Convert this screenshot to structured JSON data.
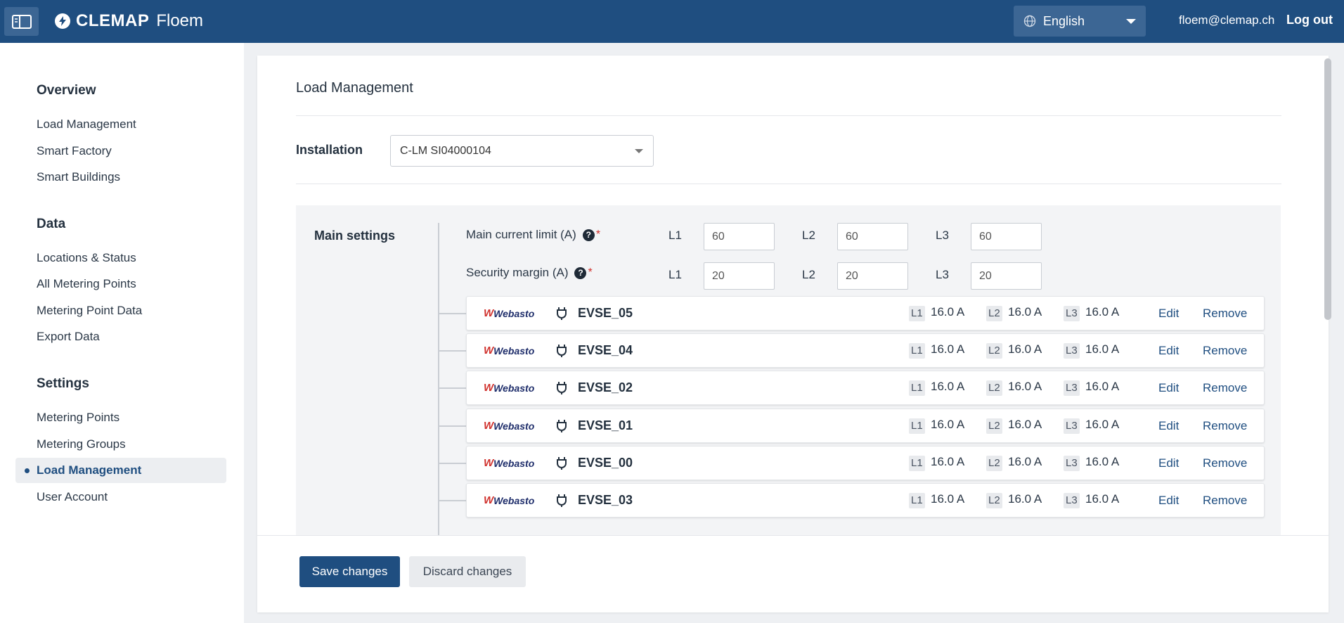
{
  "header": {
    "brand_name": "CLEMAP",
    "product_name": "Floem",
    "language": "English",
    "user_email": "floem@clemap.ch",
    "logout_label": "Log out"
  },
  "sidebar": {
    "sections": [
      {
        "heading": "Overview",
        "items": [
          "Load Management",
          "Smart Factory",
          "Smart Buildings"
        ]
      },
      {
        "heading": "Data",
        "items": [
          "Locations & Status",
          "All Metering Points",
          "Metering Point Data",
          "Export Data"
        ]
      },
      {
        "heading": "Settings",
        "items": [
          "Metering Points",
          "Metering Groups",
          "Load Management",
          "User Account"
        ]
      }
    ],
    "active_item": "Load Management"
  },
  "main": {
    "title": "Load Management",
    "installation_label": "Installation",
    "installation_value": "C-LM SI04000104",
    "main_settings_label": "Main settings",
    "main_current_limit": {
      "label": "Main current limit (A)",
      "L1": "60",
      "L2": "60",
      "L3": "60"
    },
    "security_margin": {
      "label": "Security margin (A)",
      "L1": "20",
      "L2": "20",
      "L3": "20"
    },
    "phase_labels": [
      "L1",
      "L2",
      "L3"
    ],
    "evse_rows": [
      {
        "brand": "Webasto",
        "name": "EVSE_05",
        "L1": "16.0 A",
        "L2": "16.0 A",
        "L3": "16.0 A"
      },
      {
        "brand": "Webasto",
        "name": "EVSE_04",
        "L1": "16.0 A",
        "L2": "16.0 A",
        "L3": "16.0 A"
      },
      {
        "brand": "Webasto",
        "name": "EVSE_02",
        "L1": "16.0 A",
        "L2": "16.0 A",
        "L3": "16.0 A"
      },
      {
        "brand": "Webasto",
        "name": "EVSE_01",
        "L1": "16.0 A",
        "L2": "16.0 A",
        "L3": "16.0 A"
      },
      {
        "brand": "Webasto",
        "name": "EVSE_00",
        "L1": "16.0 A",
        "L2": "16.0 A",
        "L3": "16.0 A"
      },
      {
        "brand": "Webasto",
        "name": "EVSE_03",
        "L1": "16.0 A",
        "L2": "16.0 A",
        "L3": "16.0 A"
      }
    ],
    "edit_label": "Edit",
    "remove_label": "Remove",
    "save_label": "Save changes",
    "discard_label": "Discard changes"
  },
  "colors": {
    "header_bg": "#1f4e80",
    "primary": "#1f4e80",
    "required": "#d0312d"
  },
  "icons": {
    "sidebar_toggle": "sidebar-toggle-icon",
    "brand": "bolt-icon",
    "language": "globe-icon",
    "help": "question-circle-icon",
    "charger": "plug-icon"
  }
}
